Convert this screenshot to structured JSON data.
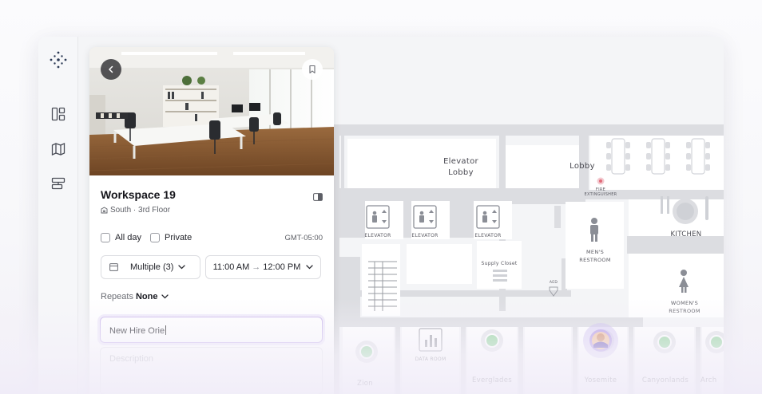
{
  "workspace": {
    "title": "Workspace 19",
    "location": "South · 3rd Floor"
  },
  "options": {
    "all_day": "All day",
    "private": "Private",
    "timezone": "GMT-05:00"
  },
  "booking": {
    "multiple": "Multiple (3)",
    "time_start": "11:00 AM",
    "time_arrow": "→",
    "time_end": "12:00 PM",
    "repeats_label": "Repeats",
    "repeats_value": "None"
  },
  "form": {
    "name_value": "New Hire Orie",
    "description_placeholder": "Description"
  },
  "floor_plan": {
    "elevator_lobby_1": "Elevator",
    "elevator_lobby_2": "Lobby",
    "lobby": "Lobby",
    "elevator": "ELEVATOR",
    "fire_1": "FIRE",
    "fire_2": "EXTINGUISHER",
    "kitchen": "KITCHEN",
    "mens_1": "MEN'S",
    "mens_2": "RESTROOM",
    "womens_1": "WOMEN'S",
    "womens_2": "RESTROOM",
    "supply_closet": "Supply Closet",
    "aed": "AED",
    "data_room": "DATA ROOM",
    "rooms": [
      "Zion",
      "Everglades",
      "Yosemite",
      "Canyonlands",
      "Arch"
    ]
  },
  "colors": {
    "accent": "#c9b8ee",
    "room_dot": "#8fd49a",
    "wall": "#dcdde1"
  },
  "icons": {
    "logo": "dots-logo-icon",
    "nav": [
      "dashboard-icon",
      "map-icon",
      "layout-icon"
    ]
  }
}
